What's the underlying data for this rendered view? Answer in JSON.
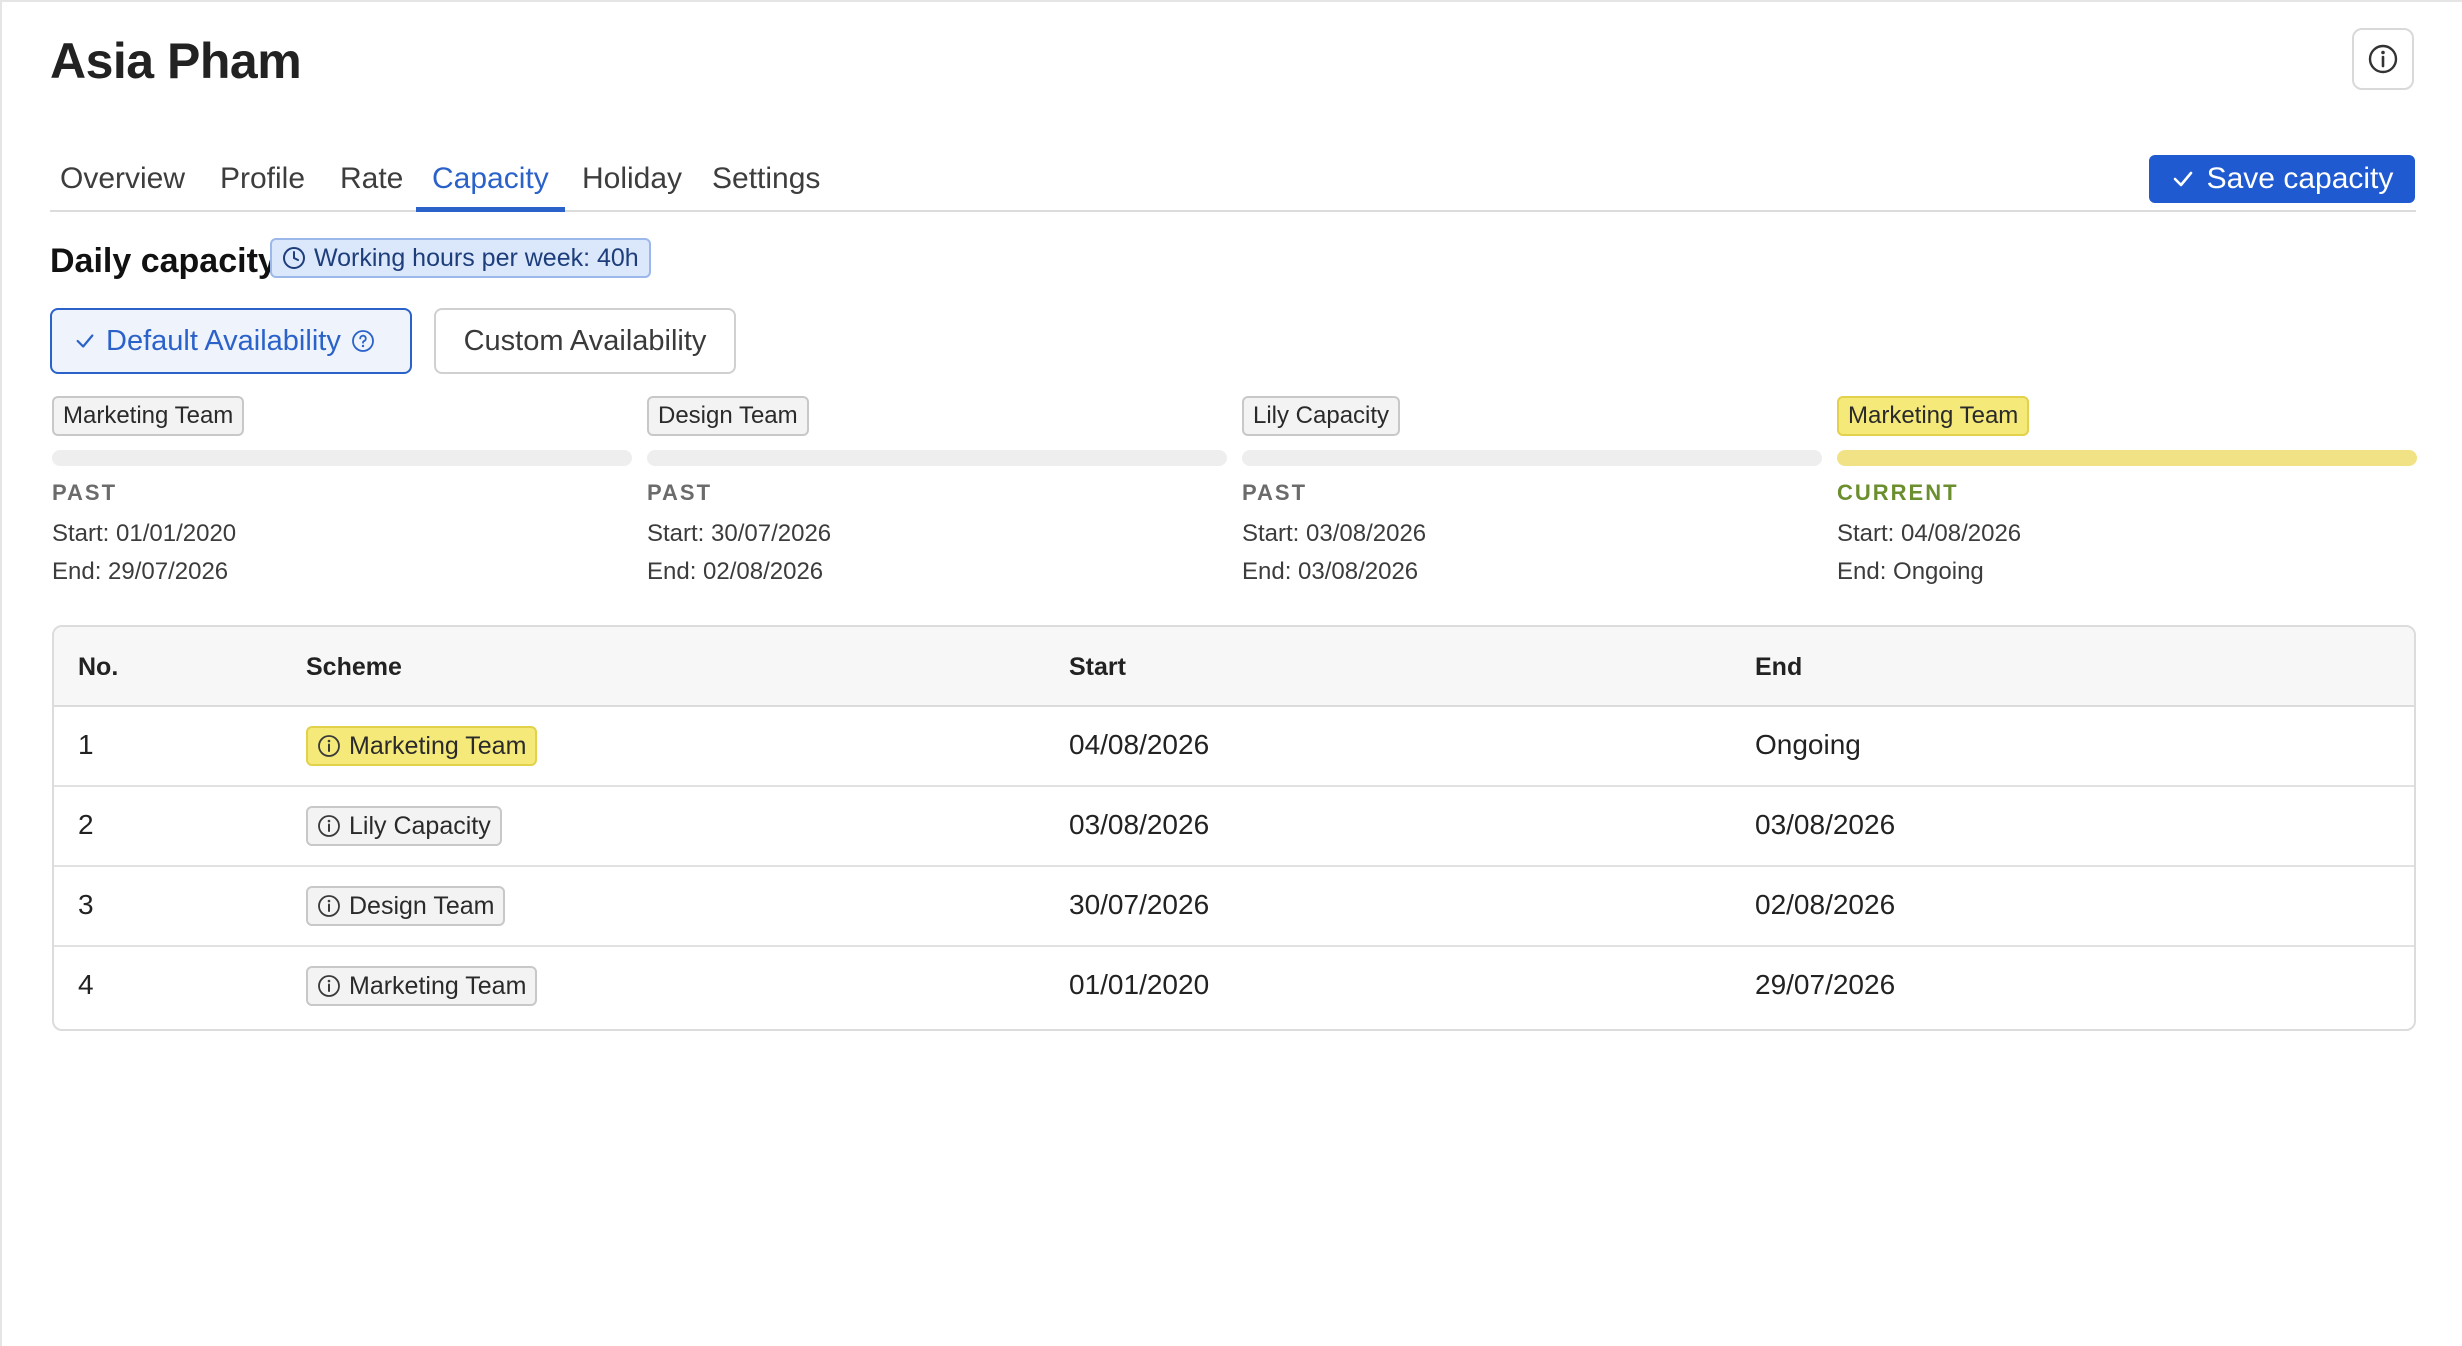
{
  "header": {
    "title": "Asia Pham"
  },
  "tabs": [
    {
      "label": "Overview"
    },
    {
      "label": "Profile"
    },
    {
      "label": "Rate"
    },
    {
      "label": "Capacity"
    },
    {
      "label": "Holiday"
    },
    {
      "label": "Settings"
    }
  ],
  "active_tab": "Capacity",
  "actions": {
    "save_label": "Save capacity"
  },
  "capacity": {
    "section_title": "Daily capacity",
    "hours_badge": "Working hours per week: 40h",
    "default_label": "Default Availability",
    "custom_label": "Custom Availability"
  },
  "timeline": [
    {
      "scheme": "Marketing Team",
      "status": "PAST",
      "start": "Start: 01/01/2020",
      "end": "End: 29/07/2026"
    },
    {
      "scheme": "Design Team",
      "status": "PAST",
      "start": "Start: 30/07/2026",
      "end": "End: 02/08/2026"
    },
    {
      "scheme": "Lily Capacity",
      "status": "PAST",
      "start": "Start: 03/08/2026",
      "end": "End: 03/08/2026"
    },
    {
      "scheme": "Marketing Team",
      "status": "CURRENT",
      "start": "Start: 04/08/2026",
      "end": "End: Ongoing"
    }
  ],
  "table": {
    "headers": {
      "no": "No.",
      "scheme": "Scheme",
      "start": "Start",
      "end": "End"
    },
    "rows": [
      {
        "no": "1",
        "scheme": "Marketing Team",
        "start": "04/08/2026",
        "end": "Ongoing"
      },
      {
        "no": "2",
        "scheme": "Lily Capacity",
        "start": "03/08/2026",
        "end": "03/08/2026"
      },
      {
        "no": "3",
        "scheme": "Design Team",
        "start": "30/07/2026",
        "end": "02/08/2026"
      },
      {
        "no": "4",
        "scheme": "Marketing Team",
        "start": "01/01/2020",
        "end": "29/07/2026"
      }
    ]
  },
  "colors": {
    "accent": "#2b62c9",
    "save_button": "#1f5ad1",
    "current_highlight": "#f5e97a",
    "current_status": "#6b8f2e"
  },
  "icons": {
    "header_info": "info-circle-icon",
    "save": "check-icon",
    "hours": "clock-icon",
    "default_check": "check-icon",
    "default_help": "question-circle-icon",
    "scheme_info": "info-circle-icon"
  }
}
